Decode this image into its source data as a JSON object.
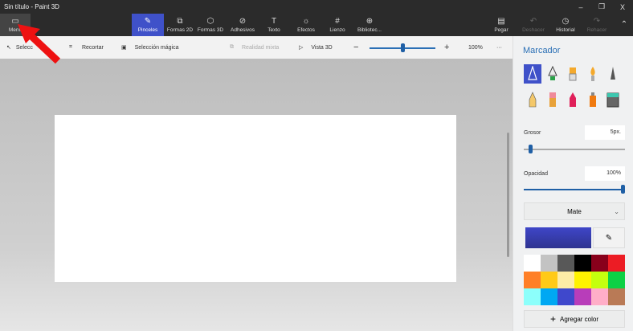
{
  "window": {
    "title": "Sin título - Paint 3D",
    "minimize": "–",
    "restore": "❐",
    "close": "X"
  },
  "ribbon": {
    "menu": "Menú",
    "tabs": [
      {
        "label": "Pinceles",
        "icon": "brush-icon"
      },
      {
        "label": "Formas 2D",
        "icon": "shapes-2d-icon"
      },
      {
        "label": "Formas 3D",
        "icon": "cube-icon"
      },
      {
        "label": "Adhesivos",
        "icon": "sticker-icon"
      },
      {
        "label": "Texto",
        "icon": "text-icon"
      },
      {
        "label": "Efectos",
        "icon": "effects-icon"
      },
      {
        "label": "Lienzo",
        "icon": "canvas-icon"
      },
      {
        "label": "Bibliotec...",
        "icon": "library-icon"
      }
    ],
    "right": {
      "paste": "Pegar",
      "undo": "Deshacer",
      "history": "Historial",
      "redo": "Rehacer"
    }
  },
  "subtoolbar": {
    "select": "Selecc",
    "crop": "Recortar",
    "magic": "Selección mágica",
    "mixed": "Realidad mixta",
    "view3d": "Vista 3D",
    "zoom": "100%",
    "zoom_fraction": 0.5,
    "more": "···"
  },
  "panel": {
    "title": "Marcador",
    "thickness_label": "Grosor",
    "thickness": "5px.",
    "thickness_fraction": 0.05,
    "opacity_label": "Opacidad",
    "opacity": "100%",
    "opacity_fraction": 1.0,
    "finish": "Mate",
    "add_color": "Agregar color",
    "current_color": "#3f46c8",
    "palette": [
      "#ffffff",
      "#c3c3c3",
      "#585858",
      "#000000",
      "#88001b",
      "#ec1c24",
      "#ff7f27",
      "#ffca18",
      "#fdeca6",
      "#fff200",
      "#c4ff0e",
      "#0ed145",
      "#8cfffb",
      "#00a8f3",
      "#3f48cc",
      "#b83dba",
      "#ffaec8",
      "#b97a56"
    ]
  },
  "annotation_color": "#ee1111"
}
